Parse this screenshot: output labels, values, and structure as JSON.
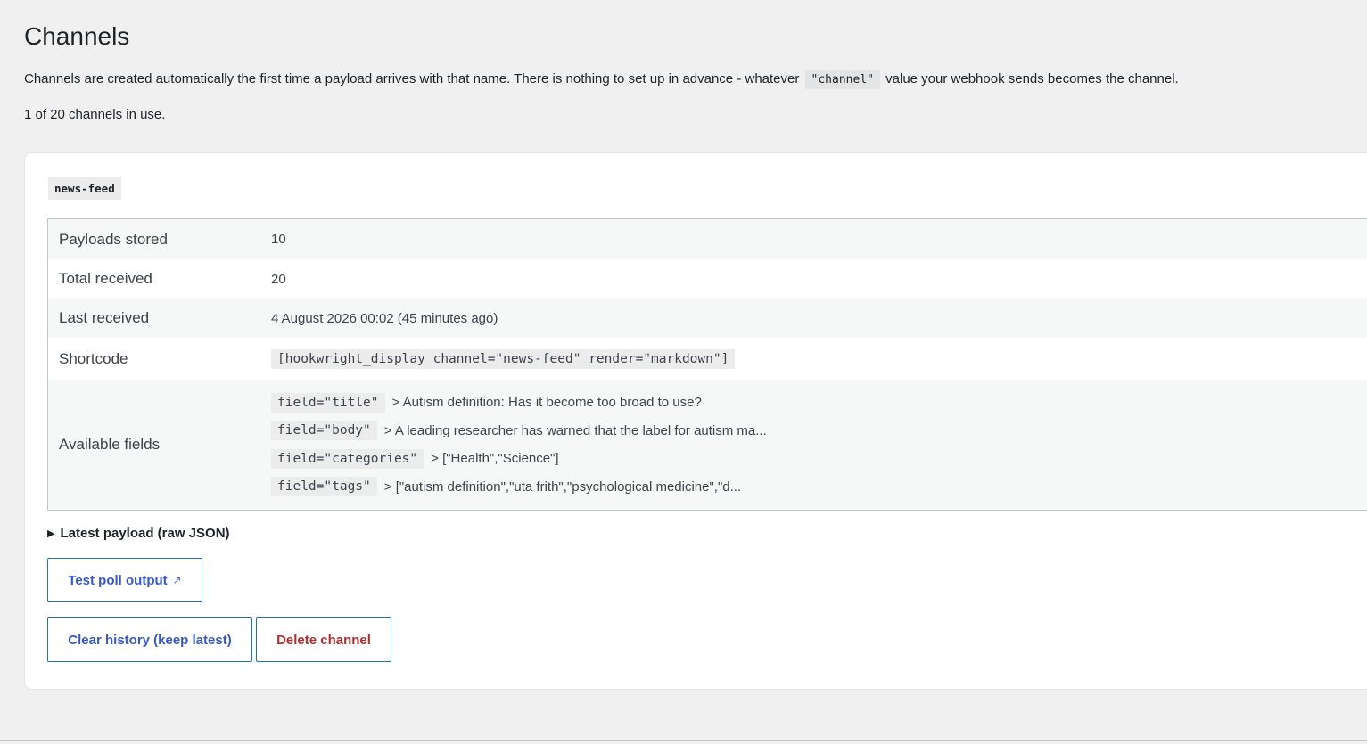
{
  "page": {
    "title": "Channels",
    "intro_before": "Channels are created automatically the first time a payload arrives with that name. There is nothing to set up in advance - whatever",
    "intro_code": "\"channel\"",
    "intro_after": "value your webhook sends becomes the channel.",
    "usage": "1 of 20 channels in use."
  },
  "channel": {
    "name": "news-feed",
    "rows": [
      {
        "label": "Payloads stored",
        "value": "10"
      },
      {
        "label": "Total received",
        "value": "20"
      },
      {
        "label": "Last received",
        "value": "4 August 2026 00:02 (45 minutes ago)"
      },
      {
        "label": "Shortcode",
        "value": "[hookwright_display channel=\"news-feed\" render=\"markdown\"]"
      }
    ],
    "fields_label": "Available fields",
    "fields": [
      {
        "code": "field=\"title\"",
        "preview": "> Autism definition: Has it become too broad to use?"
      },
      {
        "code": "field=\"body\"",
        "preview": "> A leading researcher has warned that the label for autism ma..."
      },
      {
        "code": "field=\"categories\"",
        "preview": "> [\"Health\",\"Science\"]"
      },
      {
        "code": "field=\"tags\"",
        "preview": "> [\"autism definition\",\"uta frith\",\"psychological medicine\",\"d..."
      }
    ],
    "latest_payload_label": "Latest payload (raw JSON)",
    "test_poll_label": "Test poll output",
    "clear_history_label": "Clear history (keep latest)",
    "delete_label": "Delete channel"
  },
  "icons": {
    "details_marker": "triangle-right-icon",
    "external": "external-link-icon"
  },
  "colors": {
    "link": "#3858c8",
    "danger": "#b32d2e",
    "background": "#f0f0f1"
  }
}
